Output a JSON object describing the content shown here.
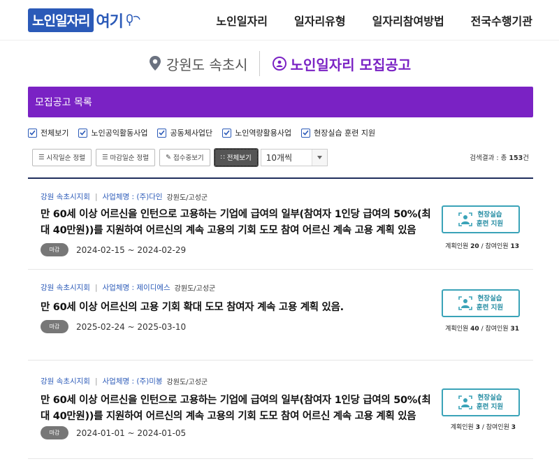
{
  "header": {
    "logo_part1": "노인일자리",
    "logo_part2": "여기",
    "nav": [
      "노인일자리",
      "일자리유형",
      "일자리참여방법",
      "전국수행기관"
    ]
  },
  "subheader": {
    "region": "강원도 속초시",
    "title": "노인일자리 모집공고"
  },
  "list_title": "모집공고 목록",
  "filters": [
    "전체보기",
    "노인공익활동사업",
    "공동체사업단",
    "노인역량활용사업",
    "현장실습 훈련 지원"
  ],
  "toolbar": {
    "sort_start": "시작일순 정렬",
    "sort_end": "마감일순 정렬",
    "accepting": "접수중보기",
    "view_all": "전체보기",
    "per_page": "10개씩",
    "result_prefix": "검색결과 : 총",
    "result_count": "153",
    "result_suffix": "건"
  },
  "cards": [
    {
      "org": "강원 속초시지회",
      "company": "사업체명 : (주)다인",
      "location": "강원도/고성군",
      "title": "만 60세 이상 어르신을 인턴으로 고용하는 기업에 급여의 일부(참여자 1인당 급여의 50%(최대 40만원))를 지원하여 어르신의 계속 고용의 기회 도모 참여 어르신 계속 고용 계획 있음",
      "badge": "마감",
      "dates": "2024-02-15 ~ 2024-02-29",
      "support_line1": "현장실습",
      "support_line2": "훈련 지원",
      "planned_label": "계획인원",
      "planned": "20",
      "participants_label": "참여인원",
      "participants": "13"
    },
    {
      "org": "강원 속초시지회",
      "company": "사업체명 : 제이디에스",
      "location": "강원도/고성군",
      "title": "만 60세 이상 어르신의 고용 기회 확대 도모 참여자 계속 고용 계획 있음.",
      "badge": "마감",
      "dates": "2025-02-24 ~ 2025-03-10",
      "support_line1": "현장실습",
      "support_line2": "훈련 지원",
      "planned_label": "계획인원",
      "planned": "40",
      "participants_label": "참여인원",
      "participants": "31"
    },
    {
      "org": "강원 속초시지회",
      "company": "사업체명 : (주)미봉",
      "location": "강원도/고성군",
      "title": "만 60세 이상 어르신을 인턴으로 고용하는 기업에 급여의 일부(참여자 1인당 급여의 50%(최대 40만원))를 지원하여 어르신의 계속 고용의 기회 도모 참여 어르신 계속 고용 계획 있음",
      "badge": "마감",
      "dates": "2024-01-01 ~ 2024-01-05",
      "support_line1": "현장실습",
      "support_line2": "훈련 지원",
      "planned_label": "계획인원",
      "planned": "3",
      "participants_label": "참여인원",
      "participants": "3"
    }
  ],
  "colors": {
    "brand_blue": "#2b5ab8",
    "purple": "#7a22c4",
    "teal": "#3aa3b8",
    "navy_divider": "#1f2d5c"
  }
}
